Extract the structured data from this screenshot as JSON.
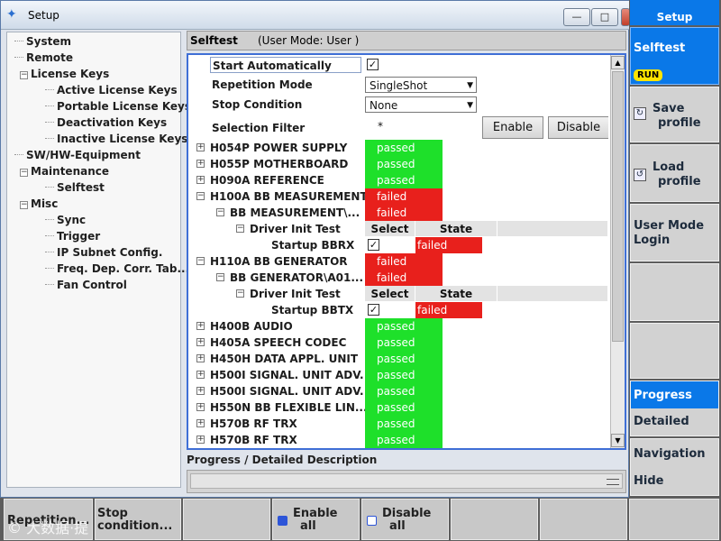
{
  "window": {
    "title": "Setup",
    "min_label": "—",
    "max_label": "□",
    "close_label": "×"
  },
  "tree": [
    {
      "label": "System",
      "marker": "dash",
      "level": 1
    },
    {
      "label": "Remote",
      "marker": "dash",
      "level": 1
    },
    {
      "label": "License Keys",
      "marker": "minus",
      "level": 0
    },
    {
      "label": "Active License Keys",
      "marker": "dash",
      "level": 2
    },
    {
      "label": "Portable License Keys",
      "marker": "dash",
      "level": 2
    },
    {
      "label": "Deactivation Keys",
      "marker": "dash",
      "level": 2
    },
    {
      "label": "Inactive License Keys",
      "marker": "dash",
      "level": 2
    },
    {
      "label": "SW/HW-Equipment",
      "marker": "dash",
      "level": 1
    },
    {
      "label": "Maintenance",
      "marker": "minus",
      "level": 0
    },
    {
      "label": "Selftest",
      "marker": "dash",
      "level": 2
    },
    {
      "label": "Misc",
      "marker": "minus",
      "level": 0
    },
    {
      "label": "Sync",
      "marker": "dash",
      "level": 2
    },
    {
      "label": "Trigger",
      "marker": "dash",
      "level": 2
    },
    {
      "label": "IP Subnet Config.",
      "marker": "dash",
      "level": 2
    },
    {
      "label": "Freq. Dep. Corr. Tab...",
      "marker": "dash",
      "level": 2
    },
    {
      "label": "Fan Control",
      "marker": "dash",
      "level": 2
    }
  ],
  "selftest": {
    "title": "Selftest",
    "user_mode_label": "(User Mode:  User                           )",
    "start_auto_label": "Start Automatically",
    "start_auto_checked": "✓",
    "repetition_label": "Repetition Mode",
    "repetition_value": "SingleShot",
    "stop_label": "Stop Condition",
    "stop_value": "None",
    "filter_label": "Selection Filter",
    "filter_value": "*",
    "enable_label": "Enable",
    "disable_label": "Disable",
    "col_select": "Select",
    "col_state": "State"
  },
  "modules": [
    {
      "name": "H054P POWER SUPPLY",
      "state": "passed"
    },
    {
      "name": "H055P MOTHERBOARD",
      "state": "passed"
    },
    {
      "name": "H090A REFERENCE",
      "state": "passed"
    },
    {
      "name": "H100A BB MEASUREMENT",
      "state": "failed",
      "sub": "BB MEASUREMENT\\...",
      "subsub": "Driver Init Test",
      "test": "Startup BBRX"
    },
    {
      "name": "H110A BB GENERATOR",
      "state": "failed",
      "sub": "BB GENERATOR\\A01...",
      "subsub": "Driver Init Test",
      "test": "Startup BBTX"
    },
    {
      "name": "H400B AUDIO",
      "state": "passed"
    },
    {
      "name": "H405A SPEECH CODEC",
      "state": "passed"
    },
    {
      "name": "H450H DATA APPL. UNIT",
      "state": "passed"
    },
    {
      "name": "H500I SIGNAL. UNIT ADV.",
      "state": "passed"
    },
    {
      "name": "H500I SIGNAL. UNIT ADV.",
      "state": "passed"
    },
    {
      "name": "H550N BB FLEXIBLE LIN...",
      "state": "passed"
    },
    {
      "name": "H570B RF TRX",
      "state": "passed"
    },
    {
      "name": "H570B RF TRX",
      "state": "passed"
    }
  ],
  "progress": {
    "label": "Progress / Detailed Description"
  },
  "softkeys_right": {
    "setup": "Setup",
    "selftest": "Selftest",
    "run_badge": "RUN",
    "save_line1": "Save",
    "save_line2": "profile",
    "load_line1": "Load",
    "load_line2": "profile",
    "usermode_line1": "User Mode",
    "usermode_line2": "Login",
    "progress": "Progress",
    "detailed": "Detailed",
    "navigation": "Navigation",
    "hide": "Hide"
  },
  "softkeys_bottom": {
    "repetition": "Repetition...",
    "stop_line1": "Stop",
    "stop_line2": "condition...",
    "enable_line1": "Enable",
    "enable_line2": "all",
    "disable_line1": "Disable",
    "disable_line2": "all"
  },
  "watermark": "© 大数据·提",
  "colors": {
    "passed": "#1ee02a",
    "failed": "#e8201c",
    "accent": "#0a78e8",
    "run": "#ffe400"
  }
}
